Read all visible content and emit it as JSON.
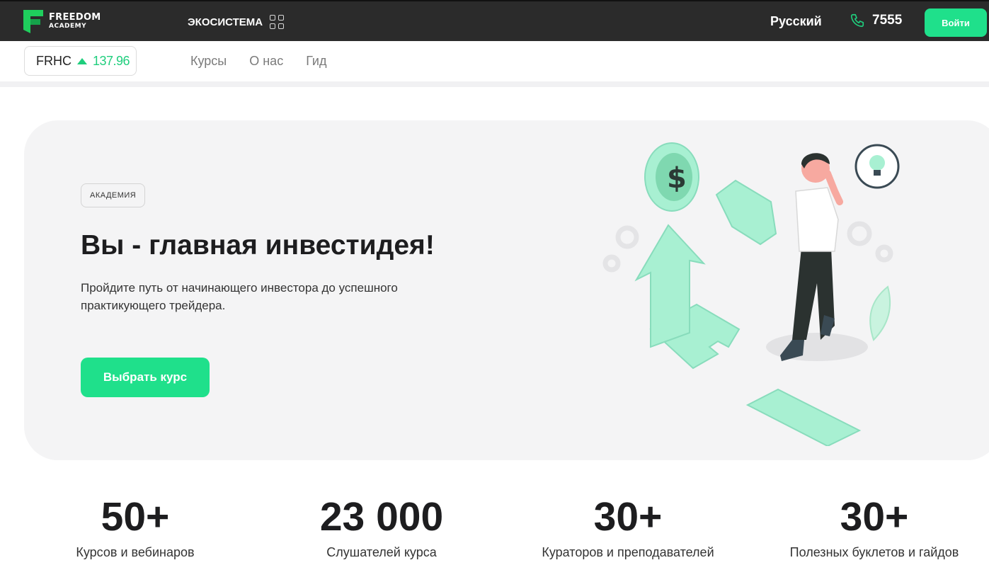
{
  "brand": {
    "line1": "FREEDOM",
    "line2": "ACADEMY",
    "accent": "#1fe08b"
  },
  "header": {
    "ecosystem_label": "ЭКОСИСТЕМА",
    "language": "Русский",
    "phone": "7555",
    "login_label": "Войти"
  },
  "ticker": {
    "symbol": "FRHC",
    "price": "137.96",
    "trend": "up"
  },
  "nav": {
    "items": [
      "Курсы",
      "О нас",
      "Гид"
    ]
  },
  "hero": {
    "badge": "АКАДЕМИЯ",
    "title": "Вы - главная инвестидея!",
    "subtitle": "Пройдите путь от начинающего инвестора до успешного практикующего трейдера.",
    "cta_label": "Выбрать курс"
  },
  "stats": [
    {
      "value": "50+",
      "label": "Курсов и вебинаров"
    },
    {
      "value": "23 000",
      "label": "Слушателей курса"
    },
    {
      "value": "30+",
      "label": "Кураторов и преподавателей"
    },
    {
      "value": "30+",
      "label": "Полезных буклетов и гайдов"
    }
  ]
}
